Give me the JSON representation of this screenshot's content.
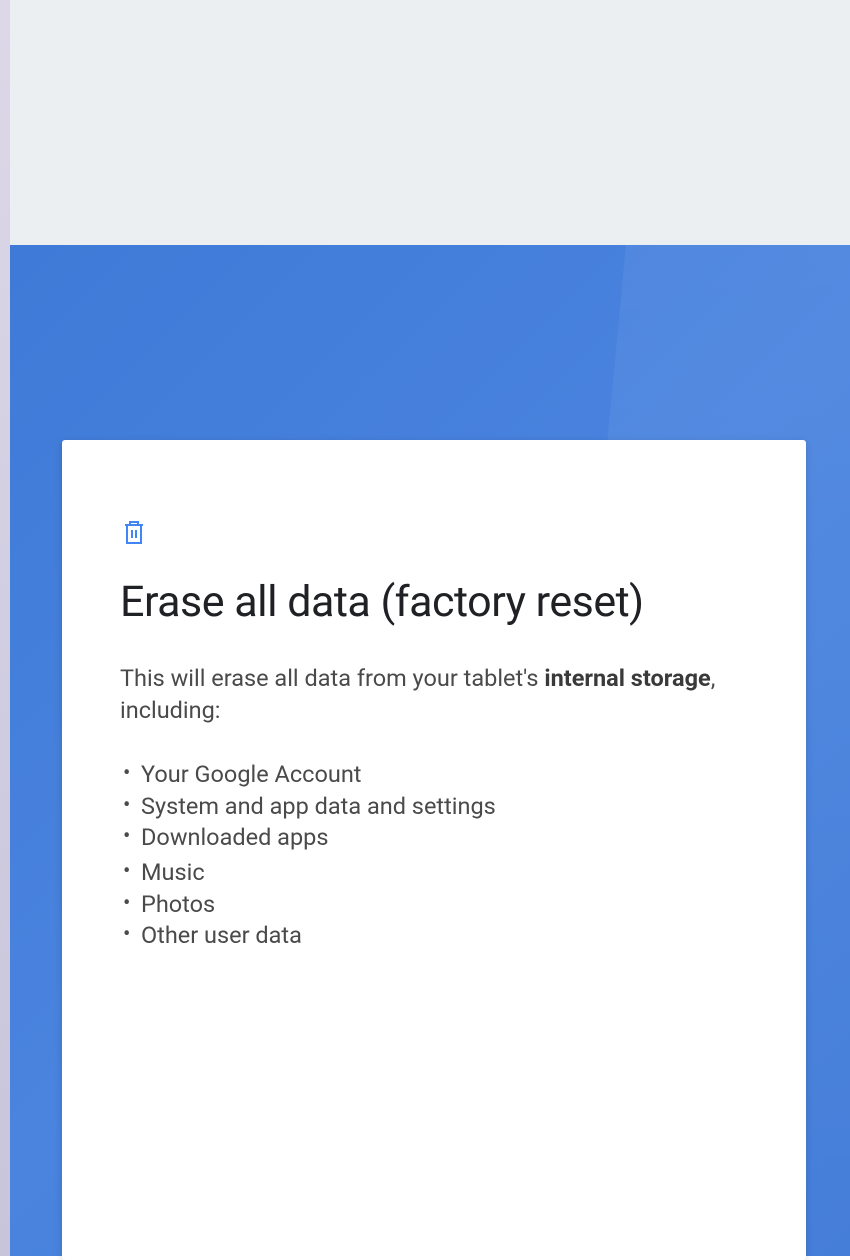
{
  "dialog": {
    "title": "Erase all data (factory reset)",
    "description_prefix": "This will erase all data from your tablet's ",
    "description_bold": "internal storage",
    "description_suffix": ", including:",
    "items": [
      "Your Google Account",
      "System and app data and settings",
      "Downloaded apps",
      "Music",
      "Photos",
      "Other user data"
    ]
  }
}
